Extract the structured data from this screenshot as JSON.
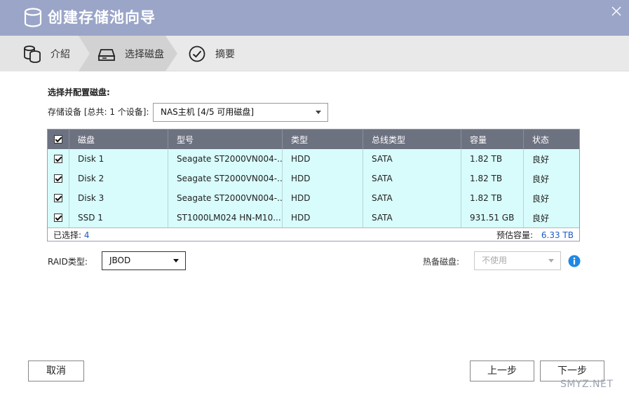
{
  "window": {
    "title": "创建存储池向导",
    "close_icon": "close-icon"
  },
  "steps": [
    {
      "label": "介紹",
      "icon": "database-icon",
      "active": false
    },
    {
      "label": "选择磁盘",
      "icon": "hard-drive-icon",
      "active": true
    },
    {
      "label": "摘要",
      "icon": "check-circle-icon",
      "active": false
    }
  ],
  "form": {
    "section_title": "选择并配置磁盘:",
    "device_label": "存储设备 [总共: 1 个设备]:",
    "device_value": "NAS主机 [4/5 可用磁盘]"
  },
  "table": {
    "headers": [
      "磁盘",
      "型号",
      "类型",
      "总线类型",
      "容量",
      "状态"
    ],
    "rows": [
      {
        "checked": true,
        "cells": [
          "Disk 1",
          "Seagate ST2000VN004-...",
          "HDD",
          "SATA",
          "1.82 TB",
          "良好"
        ]
      },
      {
        "checked": true,
        "cells": [
          "Disk 2",
          "Seagate ST2000VN004-...",
          "HDD",
          "SATA",
          "1.82 TB",
          "良好"
        ]
      },
      {
        "checked": true,
        "cells": [
          "Disk 3",
          "Seagate ST2000VN004-...",
          "HDD",
          "SATA",
          "1.82 TB",
          "良好"
        ]
      },
      {
        "checked": true,
        "cells": [
          "SSD 1",
          "ST1000LM024 HN-M10...",
          "HDD",
          "SATA",
          "931.51 GB",
          "良好"
        ]
      }
    ],
    "footer": {
      "selected_label": "已选择:",
      "selected_count": "4",
      "capacity_label": "预估容量:",
      "capacity_value": "6.33 TB"
    }
  },
  "raid": {
    "label": "RAID类型:",
    "value": "JBOD",
    "spare_label": "热备磁盘:",
    "spare_value": "不使用"
  },
  "buttons": {
    "cancel": "取消",
    "prev": "上一步",
    "next": "下一步"
  },
  "watermark": "SMYZ.NET",
  "colors": {
    "titlebar": "#9aa5c8",
    "table_header": "#6d7281",
    "row_bg": "#d8fbfb",
    "info_blue": "#1e88e5",
    "link_blue": "#1a5cc4"
  }
}
